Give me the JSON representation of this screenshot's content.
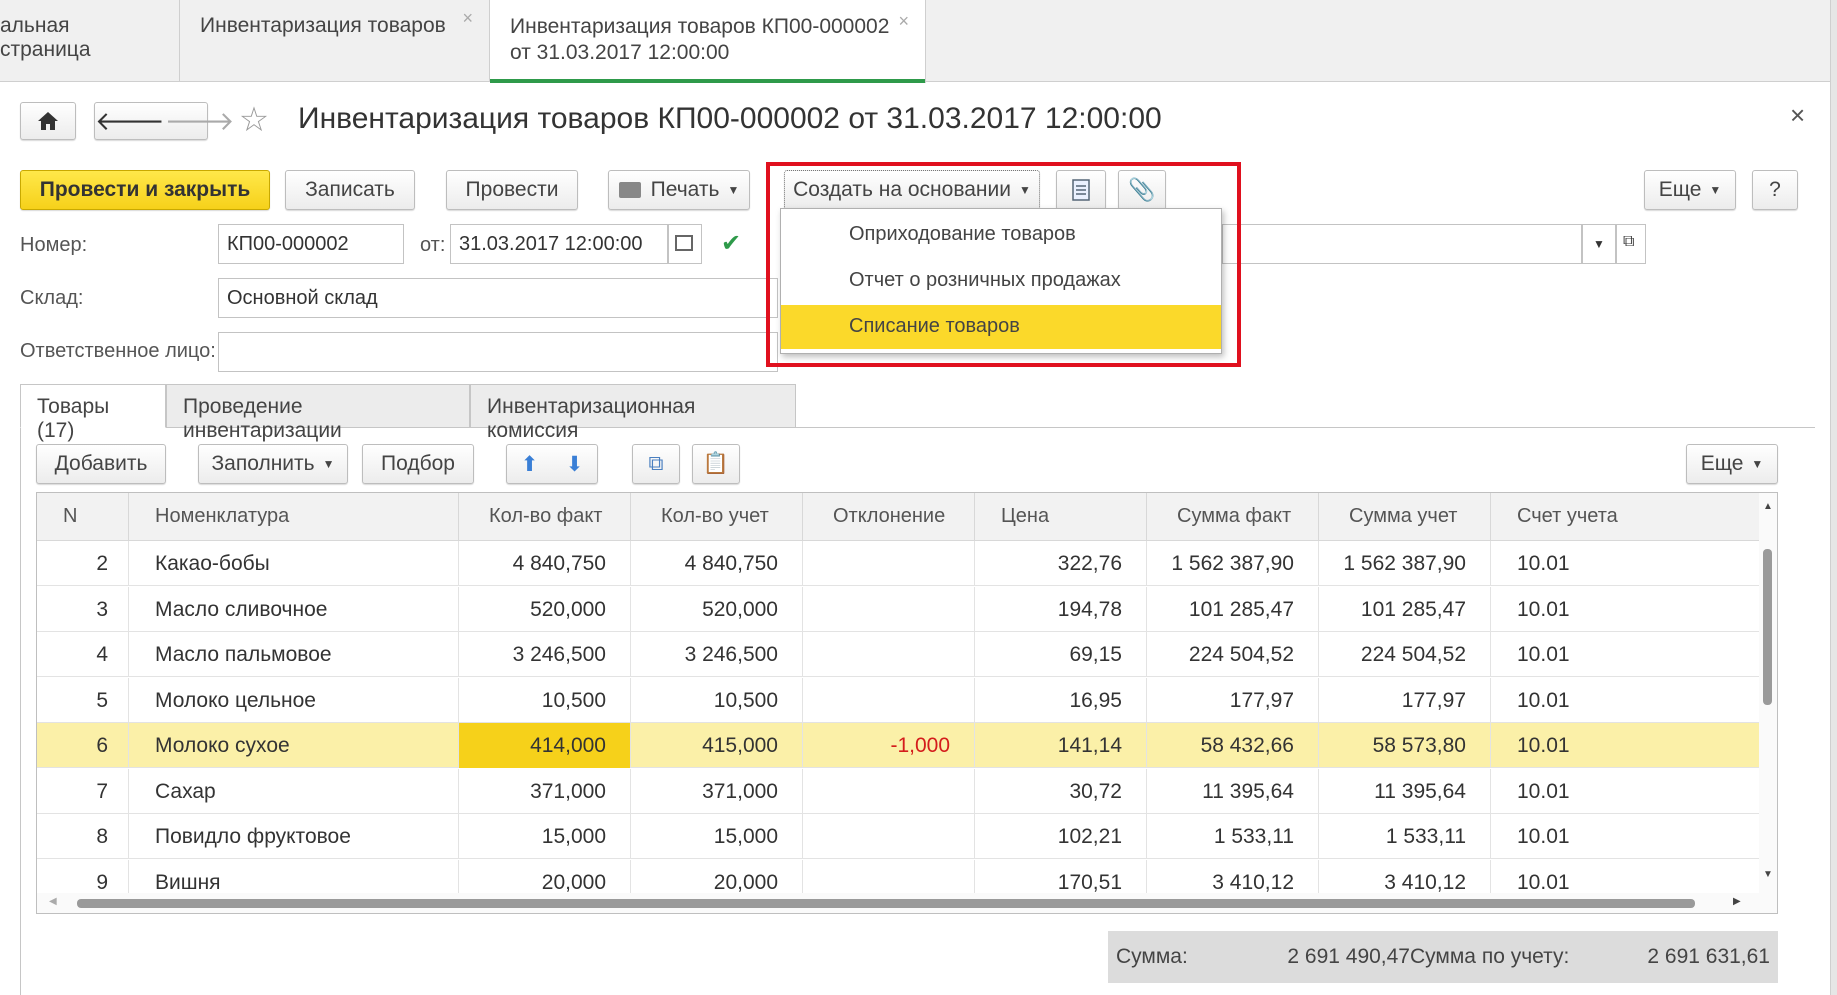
{
  "window_tabs": [
    {
      "label": "альная страница"
    },
    {
      "label": "Инвентаризация товаров"
    },
    {
      "label_line1": "Инвентаризация товаров КП00-000002",
      "label_line2": "от 31.03.2017 12:00:00"
    }
  ],
  "title": "Инвентаризация товаров КП00-000002 от 31.03.2017 12:00:00",
  "toolbar": {
    "post_close": "Провести и закрыть",
    "save": "Записать",
    "post": "Провести",
    "print": "Печать",
    "create_based": "Создать на основании",
    "more": "Еще",
    "help": "?"
  },
  "create_menu": {
    "items": [
      "Оприходование товаров",
      "Отчет о розничных продажах",
      "Списание товаров"
    ],
    "selected_index": 2
  },
  "fields": {
    "number_label": "Номер:",
    "number_value": "КП00-000002",
    "date_label": "от:",
    "date_value": "31.03.2017 12:00:00",
    "warehouse_label": "Склад:",
    "warehouse_value": "Основной склад",
    "responsible_label": "Ответственное лицо:",
    "responsible_value": ""
  },
  "page_tabs": [
    "Товары (17)",
    "Проведение инвентаризации",
    "Инвентаризационная комиссия"
  ],
  "table_toolbar": {
    "add": "Добавить",
    "fill": "Заполнить",
    "pick": "Подбор",
    "more": "Еще"
  },
  "table": {
    "headers": [
      "N",
      "Номенклатура",
      "Кол-во факт",
      "Кол-во учет",
      "Отклонение",
      "Цена",
      "Сумма факт",
      "Сумма учет",
      "Счет учета"
    ],
    "rows": [
      [
        "2",
        "Какао-бобы",
        "4 840,750",
        "4 840,750",
        "",
        "322,76",
        "1 562 387,90",
        "1 562 387,90",
        "10.01"
      ],
      [
        "3",
        "Масло сливочное",
        "520,000",
        "520,000",
        "",
        "194,78",
        "101 285,47",
        "101 285,47",
        "10.01"
      ],
      [
        "4",
        "Масло пальмовое",
        "3 246,500",
        "3 246,500",
        "",
        "69,15",
        "224 504,52",
        "224 504,52",
        "10.01"
      ],
      [
        "5",
        "Молоко цельное",
        "10,500",
        "10,500",
        "",
        "16,95",
        "177,97",
        "177,97",
        "10.01"
      ],
      [
        "6",
        "Молоко сухое",
        "414,000",
        "415,000",
        "-1,000",
        "141,14",
        "58 432,66",
        "58 573,80",
        "10.01"
      ],
      [
        "7",
        "Сахар",
        "371,000",
        "371,000",
        "",
        "30,72",
        "11 395,64",
        "11 395,64",
        "10.01"
      ],
      [
        "8",
        "Повидло фруктовое",
        "15,000",
        "15,000",
        "",
        "102,21",
        "1 533,11",
        "1 533,11",
        "10.01"
      ],
      [
        "9",
        "Вишня",
        "20,000",
        "20,000",
        "",
        "170,51",
        "3 410,12",
        "3 410,12",
        "10.01"
      ]
    ],
    "selected_row": 4
  },
  "totals": {
    "sum_label": "Сумма:",
    "sum_value": "2 691 490,47",
    "acc_label": "Сумма по учету:",
    "acc_value": "2 691 631,61"
  },
  "colors": {
    "accent_yellow": "#f6d11a",
    "selection": "#fbf0a8",
    "negative": "#d41c1c",
    "highlight_box": "#e0101e",
    "active_tab": "#2e9a4a"
  }
}
